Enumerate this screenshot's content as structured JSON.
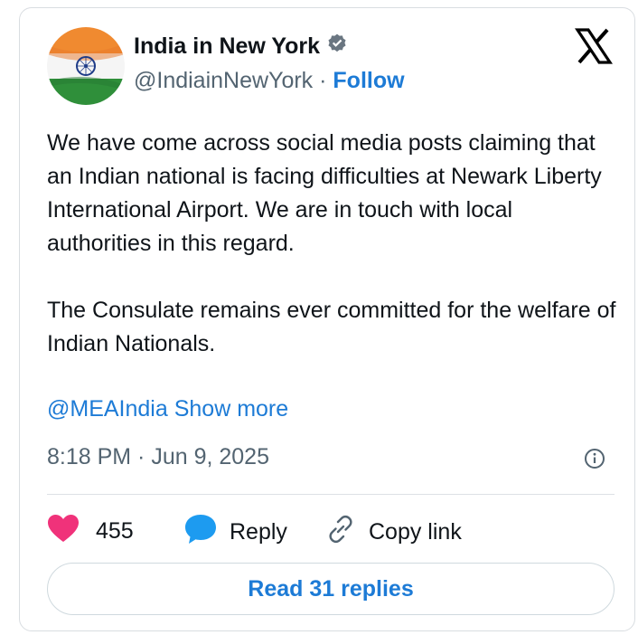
{
  "author": {
    "name": "India in New York",
    "handle": "@IndiainNewYork",
    "separator": "·",
    "follow_label": "Follow"
  },
  "tweet": {
    "paragraph1": "We have come across social media posts claiming that an Indian national is facing difficulties at Newark Liberty International Airport. We are in touch with local authorities in this regard.",
    "paragraph2": "The Consulate remains ever committed for the welfare of Indian Nationals.",
    "mention": "@MEAIndia",
    "show_more": "Show more",
    "timestamp": "8:18 PM · Jun 9, 2025"
  },
  "actions": {
    "like_count": "455",
    "reply_label": "Reply",
    "copy_link_label": "Copy link",
    "read_replies_label": "Read 31 replies"
  },
  "icons": {
    "verified": "verified-badge-icon",
    "x_logo": "x-logo-icon",
    "info": "info-icon",
    "like": "heart-icon",
    "reply": "speech-bubble-icon",
    "copy": "link-icon"
  },
  "colors": {
    "link": "#1d7bd6",
    "heart": "#f0327a",
    "reply_bubble": "#1d9bf0",
    "text": "#0f1419",
    "muted": "#536471"
  }
}
